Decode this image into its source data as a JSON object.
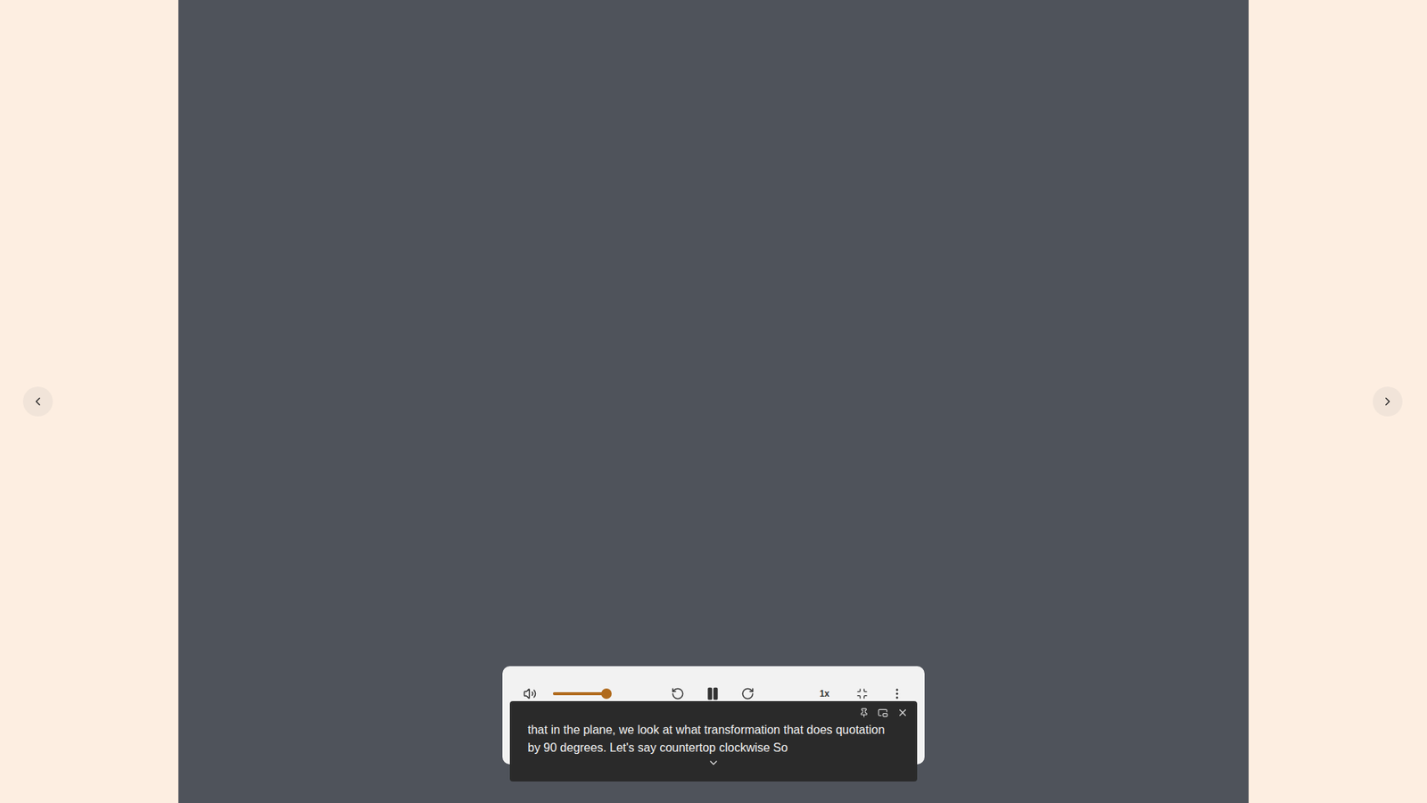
{
  "player": {
    "playing": true,
    "volume": {
      "level": 1
    },
    "speed": "1x"
  },
  "captions": {
    "text": "that in the plane, we look at what transformation that does quotation by 90 degrees. Let's say countertop clockwise So",
    "expanded": false
  }
}
